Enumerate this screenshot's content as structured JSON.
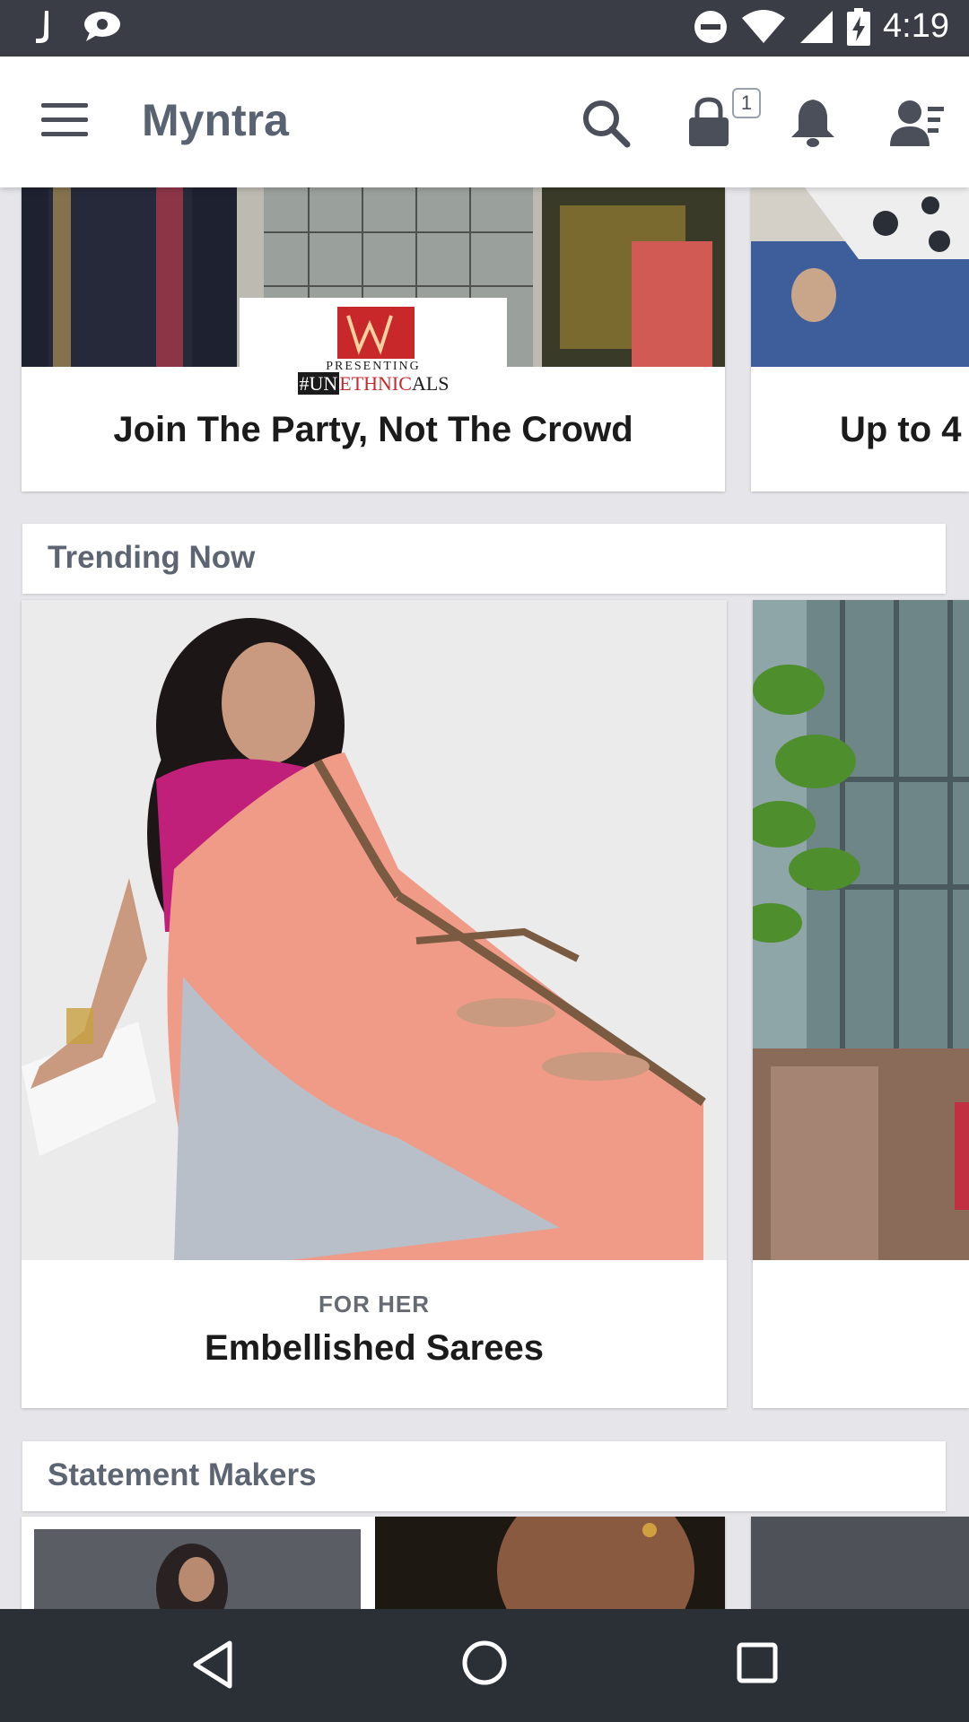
{
  "status_bar": {
    "time": "4:19",
    "icons": [
      "j-app-icon",
      "chat-icon",
      "dnd-icon",
      "wifi-icon",
      "signal-icon",
      "battery-charging-icon"
    ]
  },
  "app_bar": {
    "title": "Myntra",
    "bag_count": "1",
    "icons": [
      "menu-icon",
      "search-icon",
      "bag-icon",
      "bell-icon",
      "profile-icon"
    ]
  },
  "banners": [
    {
      "logo_top": "PRESENTING",
      "logo_tag_prefix": "#UN",
      "logo_tag_mid": "ETHNIC",
      "logo_tag_suffix": "ALS",
      "title": "Join The Party, Not The Crowd"
    },
    {
      "title": "Up to 4"
    }
  ],
  "sections": [
    {
      "title": "Trending Now",
      "cards": [
        {
          "subtitle": "FOR HER",
          "title": "Embellished Sarees"
        }
      ]
    },
    {
      "title": "Statement Makers"
    }
  ],
  "colors": {
    "status_bar": "#3a3d45",
    "nav_bar": "#2b2f36",
    "title": "#596270",
    "background": "#e6e6ea"
  }
}
